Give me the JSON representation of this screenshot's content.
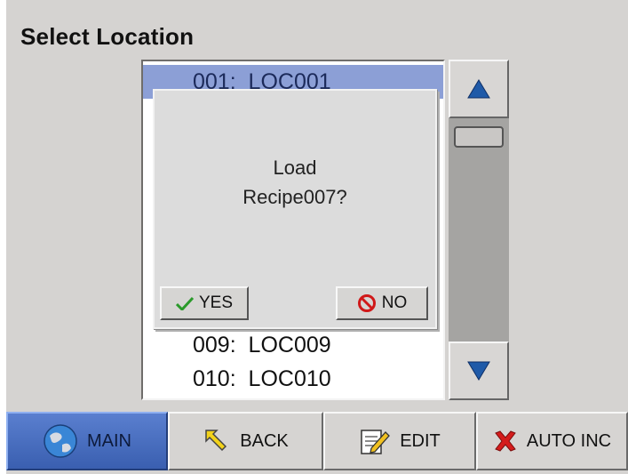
{
  "header": {
    "title": "Select Location"
  },
  "list": {
    "items": [
      {
        "label": "001:  LOC001"
      },
      {
        "label": "009:  LOC009"
      },
      {
        "label": "010:  LOC010"
      }
    ]
  },
  "scroll": {
    "up_icon": "triangle-up-icon",
    "down_icon": "triangle-down-icon"
  },
  "dialog": {
    "line1": "Load",
    "line2": "Recipe007?",
    "yes_label": "YES",
    "no_label": "NO"
  },
  "nav": {
    "main_label": "MAIN",
    "back_label": "BACK",
    "edit_label": "EDIT",
    "auto_inc_label": "AUTO INC"
  },
  "colors": {
    "selection": "#8c9fd6",
    "main_active": "#4a6fc0",
    "arrow_blue": "#1f5aa8",
    "no_red": "#d01818",
    "yes_green": "#2a9a2a"
  }
}
